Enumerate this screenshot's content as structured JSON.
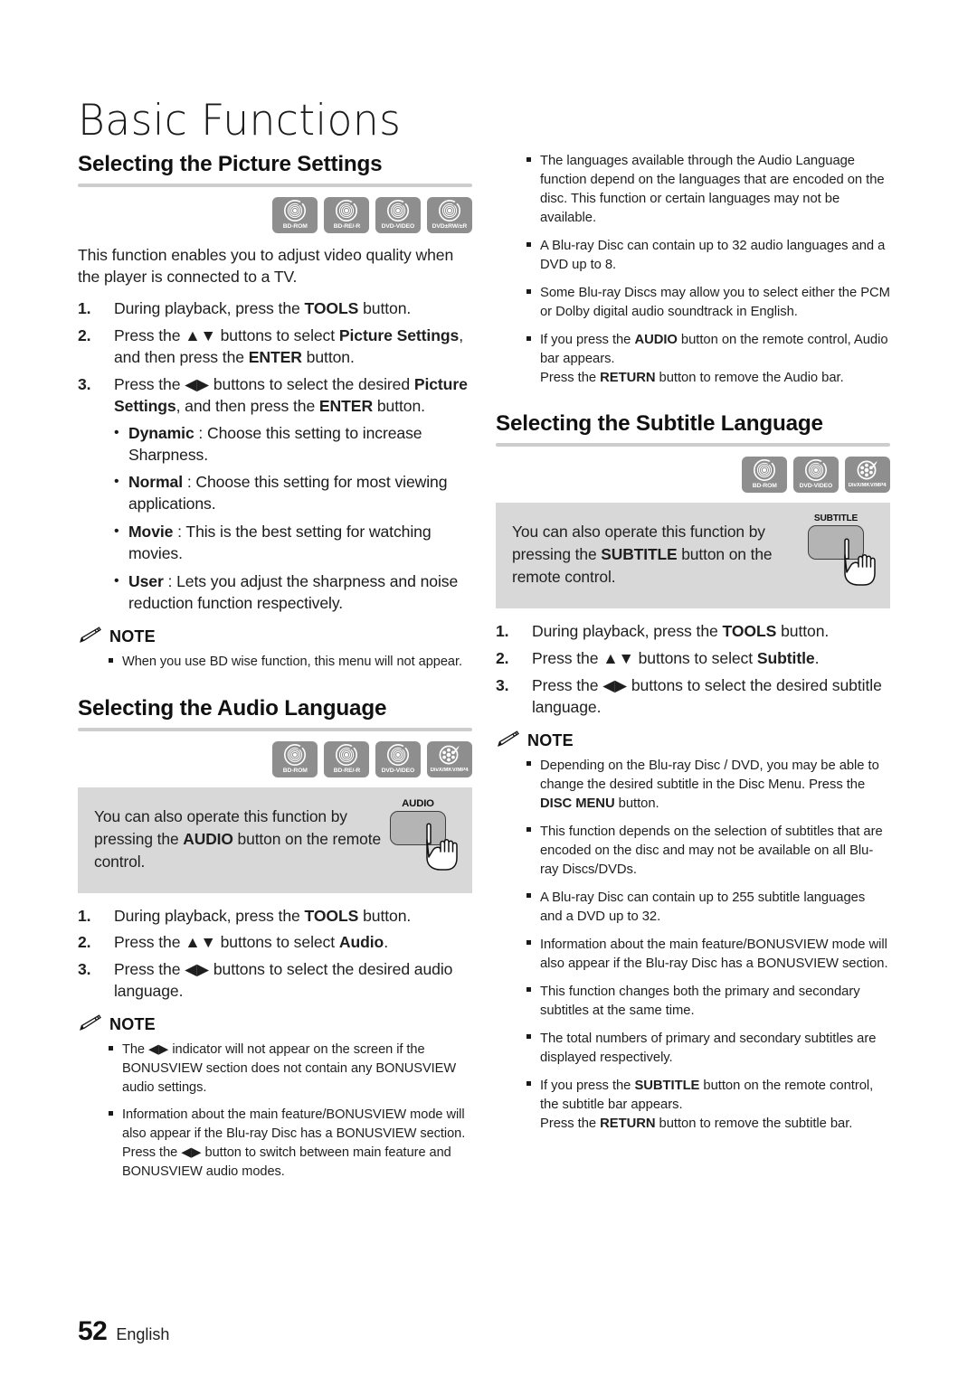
{
  "chapter": {
    "title": "Basic Functions"
  },
  "footer": {
    "page_number": "52",
    "language": "English"
  },
  "note_label": "NOTE",
  "sections": {
    "picture": {
      "heading": "Selecting the Picture Settings",
      "discs": [
        {
          "label": "BD-ROM",
          "icon": "disc-icon"
        },
        {
          "label": "BD-RE/-R",
          "icon": "disc-icon"
        },
        {
          "label": "DVD-VIDEO",
          "icon": "disc-icon"
        },
        {
          "label": "DVD±RW/±R",
          "icon": "disc-icon"
        }
      ],
      "intro": "This function enables you to adjust video quality when the player is connected to a TV.",
      "steps": [
        {
          "num": "1.",
          "text_html": "During playback, press the <b>TOOLS</b> button."
        },
        {
          "num": "2.",
          "text_html": "Press the ▲▼ buttons to select <b>Picture Settings</b>, and then press the <b>ENTER</b> button."
        },
        {
          "num": "3.",
          "text_html": "Press the ◀▶ buttons to select the desired <b>Picture Settings</b>, and then press the <b>ENTER</b> button."
        }
      ],
      "options": [
        {
          "text_html": "<b>Dynamic</b> : Choose this setting to increase Sharpness."
        },
        {
          "text_html": "<b>Normal</b> : Choose this setting for most viewing applications."
        },
        {
          "text_html": "<b>Movie</b> : This is the best setting for watching movies."
        },
        {
          "text_html": "<b>User</b> : Lets you adjust the sharpness and noise reduction function respectively."
        }
      ],
      "notes": [
        {
          "text_html": "When you use BD wise function, this menu will not appear."
        }
      ]
    },
    "audio": {
      "heading": "Selecting the Audio Language",
      "discs": [
        {
          "label": "BD-ROM",
          "icon": "disc-icon"
        },
        {
          "label": "BD-RE/-R",
          "icon": "disc-icon"
        },
        {
          "label": "DVD-VIDEO",
          "icon": "disc-icon"
        },
        {
          "label": "DivX/MKV/MP4",
          "icon": "film-icon"
        }
      ],
      "tip": {
        "text_html": "You can also operate this function by pressing the <b>AUDIO</b> button on the remote control.",
        "remote_button_label": "AUDIO"
      },
      "steps": [
        {
          "num": "1.",
          "text_html": "During playback, press the <b>TOOLS</b> button."
        },
        {
          "num": "2.",
          "text_html": "Press the ▲▼ buttons to select <b>Audio</b>."
        },
        {
          "num": "3.",
          "text_html": "Press the ◀▶ buttons to select the desired audio language."
        }
      ],
      "notes": [
        {
          "text_html": "The ◀▶ indicator will not appear on the screen if the BONUSVIEW section does not contain any BONUSVIEW audio settings."
        },
        {
          "text_html": "Information about the main feature/BONUSVIEW mode will also appear if the Blu-ray Disc has a BONUSVIEW section.<br>Press the ◀▶ button to switch between main feature and BONUSVIEW audio modes."
        }
      ]
    },
    "audio_top_notes": [
      {
        "text_html": "The languages available through the Audio Language function depend on the languages that are encoded on the disc. This function or certain languages may not be available."
      },
      {
        "text_html": "A Blu-ray Disc can contain up to 32 audio languages and a DVD up to 8."
      },
      {
        "text_html": "Some Blu-ray Discs may allow you to select either the PCM or Dolby digital audio soundtrack in English."
      },
      {
        "text_html": "If you press the <b>AUDIO</b> button on the remote control, Audio bar appears.<br>Press the <b>RETURN</b> button to remove the Audio bar."
      }
    ],
    "subtitle": {
      "heading": "Selecting the Subtitle Language",
      "discs": [
        {
          "label": "BD-ROM",
          "icon": "disc-icon"
        },
        {
          "label": "DVD-VIDEO",
          "icon": "disc-icon"
        },
        {
          "label": "DivX/MKV/MP4",
          "icon": "film-icon"
        }
      ],
      "tip": {
        "text_html": "You can also operate this function by pressing the <b>SUBTITLE</b> button on the remote control.",
        "remote_button_label": "SUBTITLE"
      },
      "steps": [
        {
          "num": "1.",
          "text_html": "During playback, press the <b>TOOLS</b> button."
        },
        {
          "num": "2.",
          "text_html": "Press the ▲▼ buttons to select <b>Subtitle</b>."
        },
        {
          "num": "3.",
          "text_html": "Press the ◀▶ buttons to select the desired subtitle language."
        }
      ],
      "notes": [
        {
          "text_html": "Depending on the Blu-ray Disc / DVD, you may be able to change the desired subtitle in the Disc Menu. Press the <b>DISC MENU</b> button."
        },
        {
          "text_html": "This function depends on the selection of subtitles that are encoded on the disc and may not be available on all Blu-ray Discs/DVDs."
        },
        {
          "text_html": "A Blu-ray Disc can contain up to 255 subtitle languages and a DVD up to 32."
        },
        {
          "text_html": "Information about the main feature/BONUSVIEW mode will also appear if the Blu-ray Disc has a BONUSVIEW section."
        },
        {
          "text_html": "This function changes both the primary and secondary subtitles at the same time."
        },
        {
          "text_html": "The total numbers of primary and secondary subtitles are displayed respectively."
        },
        {
          "text_html": "If you press the <b>SUBTITLE</b> button on the remote control, the subtitle bar appears.<br>Press the <b>RETURN</b> button to remove the subtitle bar."
        }
      ]
    }
  },
  "colors": {
    "disc_badge": "#8e8e8e",
    "rule": "#cdcdcd",
    "tip_background": "#d8d8d8",
    "remote_key": "#b4b4b4"
  }
}
